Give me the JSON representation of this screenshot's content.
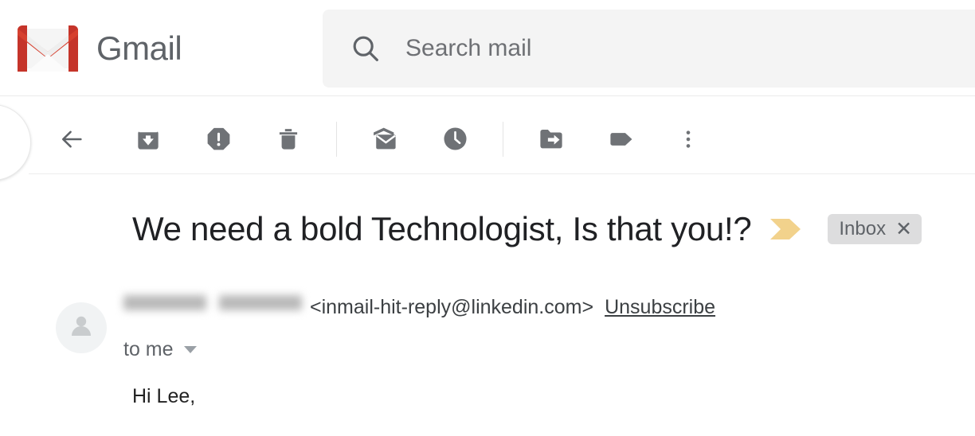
{
  "app": {
    "brand_name": "Gmail",
    "logo_icon": "gmail-envelope-m-icon",
    "brand_color": "#d14836"
  },
  "search": {
    "icon": "search-icon",
    "placeholder": "Search mail",
    "value": ""
  },
  "compose": {
    "label": "",
    "icon": "compose-fab-icon"
  },
  "toolbar": {
    "items": [
      {
        "name": "back-button",
        "icon": "arrow-left-icon",
        "tooltip": "Back to Inbox"
      },
      {
        "name": "archive-button",
        "icon": "archive-icon",
        "tooltip": "Archive"
      },
      {
        "name": "report-spam-button",
        "icon": "report-spam-icon",
        "tooltip": "Report spam"
      },
      {
        "name": "delete-button",
        "icon": "trash-icon",
        "tooltip": "Delete"
      },
      {
        "name": "mark-unread-button",
        "icon": "envelope-open-icon",
        "tooltip": "Mark as unread"
      },
      {
        "name": "snooze-button",
        "icon": "clock-icon",
        "tooltip": "Snooze"
      },
      {
        "name": "move-to-button",
        "icon": "folder-arrow-icon",
        "tooltip": "Move to"
      },
      {
        "name": "labels-button",
        "icon": "tag-icon",
        "tooltip": "Labels"
      },
      {
        "name": "more-button",
        "icon": "more-vertical-icon",
        "tooltip": "More"
      }
    ]
  },
  "message": {
    "subject": "We need a bold Technologist, Is that you!?",
    "importance_marker_icon": "importance-chevron-icon",
    "importance_marker_color": "#f2d28c",
    "label": {
      "text": "Inbox",
      "close": "✕",
      "background": "#ddddde"
    },
    "sender": {
      "avatar_icon": "person-avatar-icon",
      "name_redacted": true,
      "email": "<inmail-hit-reply@linkedin.com>",
      "unsubscribe_label": "Unsubscribe"
    },
    "recipient_label": "to me",
    "recipient_caret_icon": "chevron-down-icon",
    "body_text": "Hi Lee,"
  }
}
